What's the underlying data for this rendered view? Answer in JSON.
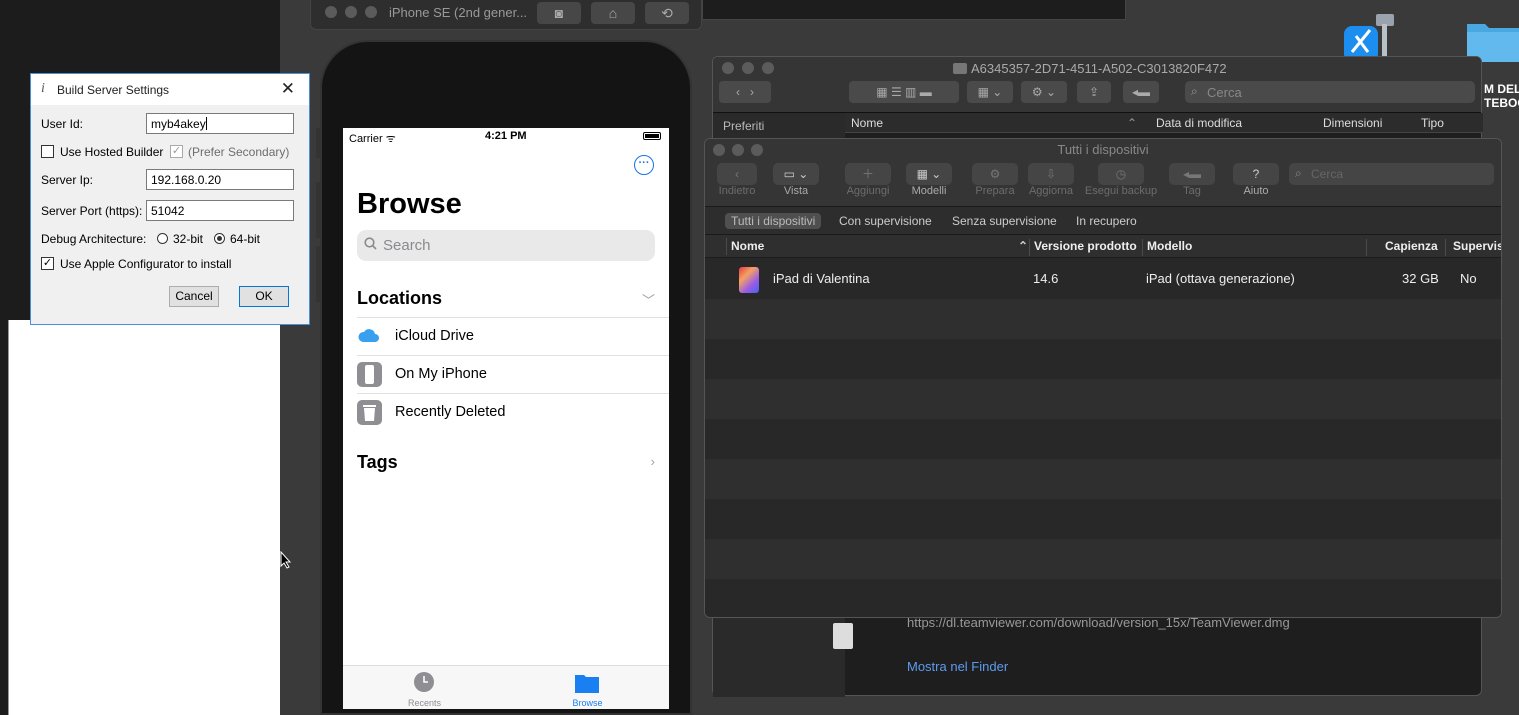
{
  "simulator": {
    "title": "iPhone SE (2nd gener...",
    "screenshot_icon": "camera-icon",
    "home_icon": "home-icon",
    "rotate_icon": "rotate-icon"
  },
  "phone": {
    "carrier": "Carrier",
    "time": "4:21 PM",
    "title": "Browse",
    "search_placeholder": "Search",
    "locations_title": "Locations",
    "locations": [
      {
        "label": "iCloud Drive",
        "icon": "icloud-icon"
      },
      {
        "label": "On My iPhone",
        "icon": "iphone-icon"
      },
      {
        "label": "Recently Deleted",
        "icon": "trash-icon"
      }
    ],
    "tags_title": "Tags",
    "tabs": [
      {
        "label": "Recents",
        "icon": "clock-icon"
      },
      {
        "label": "Browse",
        "icon": "folder-icon"
      }
    ],
    "accent_color": "#1a73e8"
  },
  "finder": {
    "title": "A6345357-2D71-4511-A502-C3013820F472",
    "search_placeholder": "Cerca",
    "sidebar_title": "Preferiti",
    "columns": [
      "Nome",
      "Data di modifica",
      "Dimensioni",
      "Tipo"
    ],
    "download_url": "https://dl.teamviewer.com/download/version_15x/TeamViewer.dmg",
    "show_in_finder": "Mostra nel Finder"
  },
  "configurator": {
    "title": "Tutti i dispositivi",
    "toolbar": [
      {
        "label": "Indietro",
        "icon": "back-arrow-icon",
        "enabled": false
      },
      {
        "label": "Vista",
        "icon": "view-icon",
        "enabled": true
      },
      {
        "label": "Aggiungi",
        "icon": "add-icon",
        "enabled": false
      },
      {
        "label": "Modelli",
        "icon": "grid-icon",
        "enabled": true
      },
      {
        "label": "Prepara",
        "icon": "prepare-icon",
        "enabled": false
      },
      {
        "label": "Aggiorna",
        "icon": "update-icon",
        "enabled": false
      },
      {
        "label": "Esegui backup",
        "icon": "backup-icon",
        "enabled": false
      },
      {
        "label": "Tag",
        "icon": "tag-icon",
        "enabled": false
      },
      {
        "label": "Aiuto",
        "icon": "help-icon",
        "enabled": true
      }
    ],
    "search_placeholder": "Cerca",
    "filters": [
      "Tutti i dispositivi",
      "Con supervisione",
      "Senza supervisione",
      "In recupero"
    ],
    "columns": [
      "Nome",
      "Versione prodotto",
      "Modello",
      "Capienza",
      "Supervisi"
    ],
    "devices": [
      {
        "name": "iPad di Valentina",
        "version": "14.6",
        "model": "iPad (ottava generazione)",
        "capacity": "32 GB",
        "supervised": "No"
      }
    ]
  },
  "dialog": {
    "title": "Build Server Settings",
    "info_icon": "i",
    "user_id_label": "User Id:",
    "user_id_value": "myb4akey",
    "use_hosted_label": "Use Hosted Builder",
    "prefer_secondary_label": "(Prefer Secondary)",
    "server_ip_label": "Server Ip:",
    "server_ip_value": "192.168.0.20",
    "server_port_label": "Server Port (https):",
    "server_port_value": "51042",
    "debug_arch_label": "Debug Architecture:",
    "arch_32": "32-bit",
    "arch_64": "64-bit",
    "use_configurator_label": "Use Apple Configurator to install",
    "cancel": "Cancel",
    "ok": "OK"
  },
  "desktop": {
    "label_line1": "M DEL",
    "label_line2": "TEBOO"
  }
}
